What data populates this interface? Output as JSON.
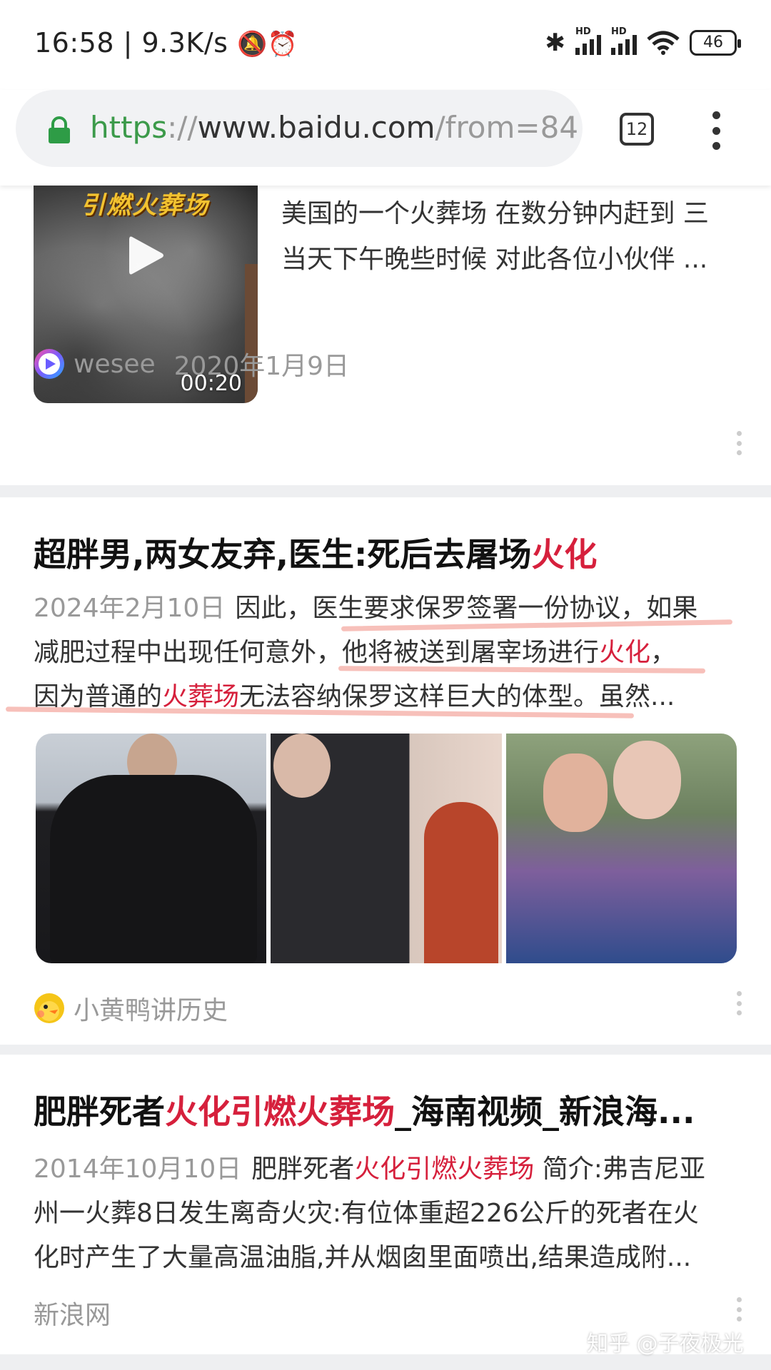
{
  "status_bar": {
    "time": "16:58",
    "net_speed": "9.3K/s",
    "battery": "46"
  },
  "browser": {
    "url_scheme": "https",
    "url_sep": "://",
    "url_host": "www.baidu.com",
    "url_rest": "/from=84",
    "tab_count": "12"
  },
  "results": [
    {
      "thumbnail_title": "引燃火葬场",
      "duration": "00:20",
      "snippet_lines": [
        "美国的一个火葬场 在数分钟内赶到 三",
        "当天下午晚些时候 对此各位小伙伴 ..."
      ],
      "source": "wesee",
      "date": "2020年1月9日"
    },
    {
      "title_prefix": "超胖男,两女友弃,医生:死后去屠场",
      "title_highlight": "火化",
      "date": "2024年2月10日",
      "line1_text": "因此，医生要求保罗签署一份协议，如果",
      "line2_prefix": "减肥过程中出现任何意外，他将被送到屠宰场进行",
      "line2_highlight": "火化",
      "line2_suffix": "，",
      "line3_prefix": "因为普通的",
      "line3_highlight": "火葬场",
      "line3_suffix": "无法容纳保罗这样巨大的体型。虽然...",
      "source": "小黄鸭讲历史"
    },
    {
      "title_prefix": "肥胖死者",
      "title_highlight": "火化引燃火葬场",
      "title_suffix": "_海南视频_新浪海...",
      "date": "2014年10月10日",
      "line1_prefix": "肥胖死者",
      "line1_highlight": "火化引燃火葬场",
      "line1_suffix": " 简介:弗吉尼亚",
      "line2": "州一火葬8日发生离奇火灾:有位体重超226公斤的死者在火",
      "line3": "化时产生了大量高温油脂,并从烟囱里面喷出,结果造成附...",
      "source": "新浪网"
    }
  ],
  "watermark": "知乎 @子夜极光",
  "colors": {
    "highlight": "#d6203c",
    "secure_green": "#3c9a4a",
    "underline_annotation": "#f6b9b2"
  }
}
